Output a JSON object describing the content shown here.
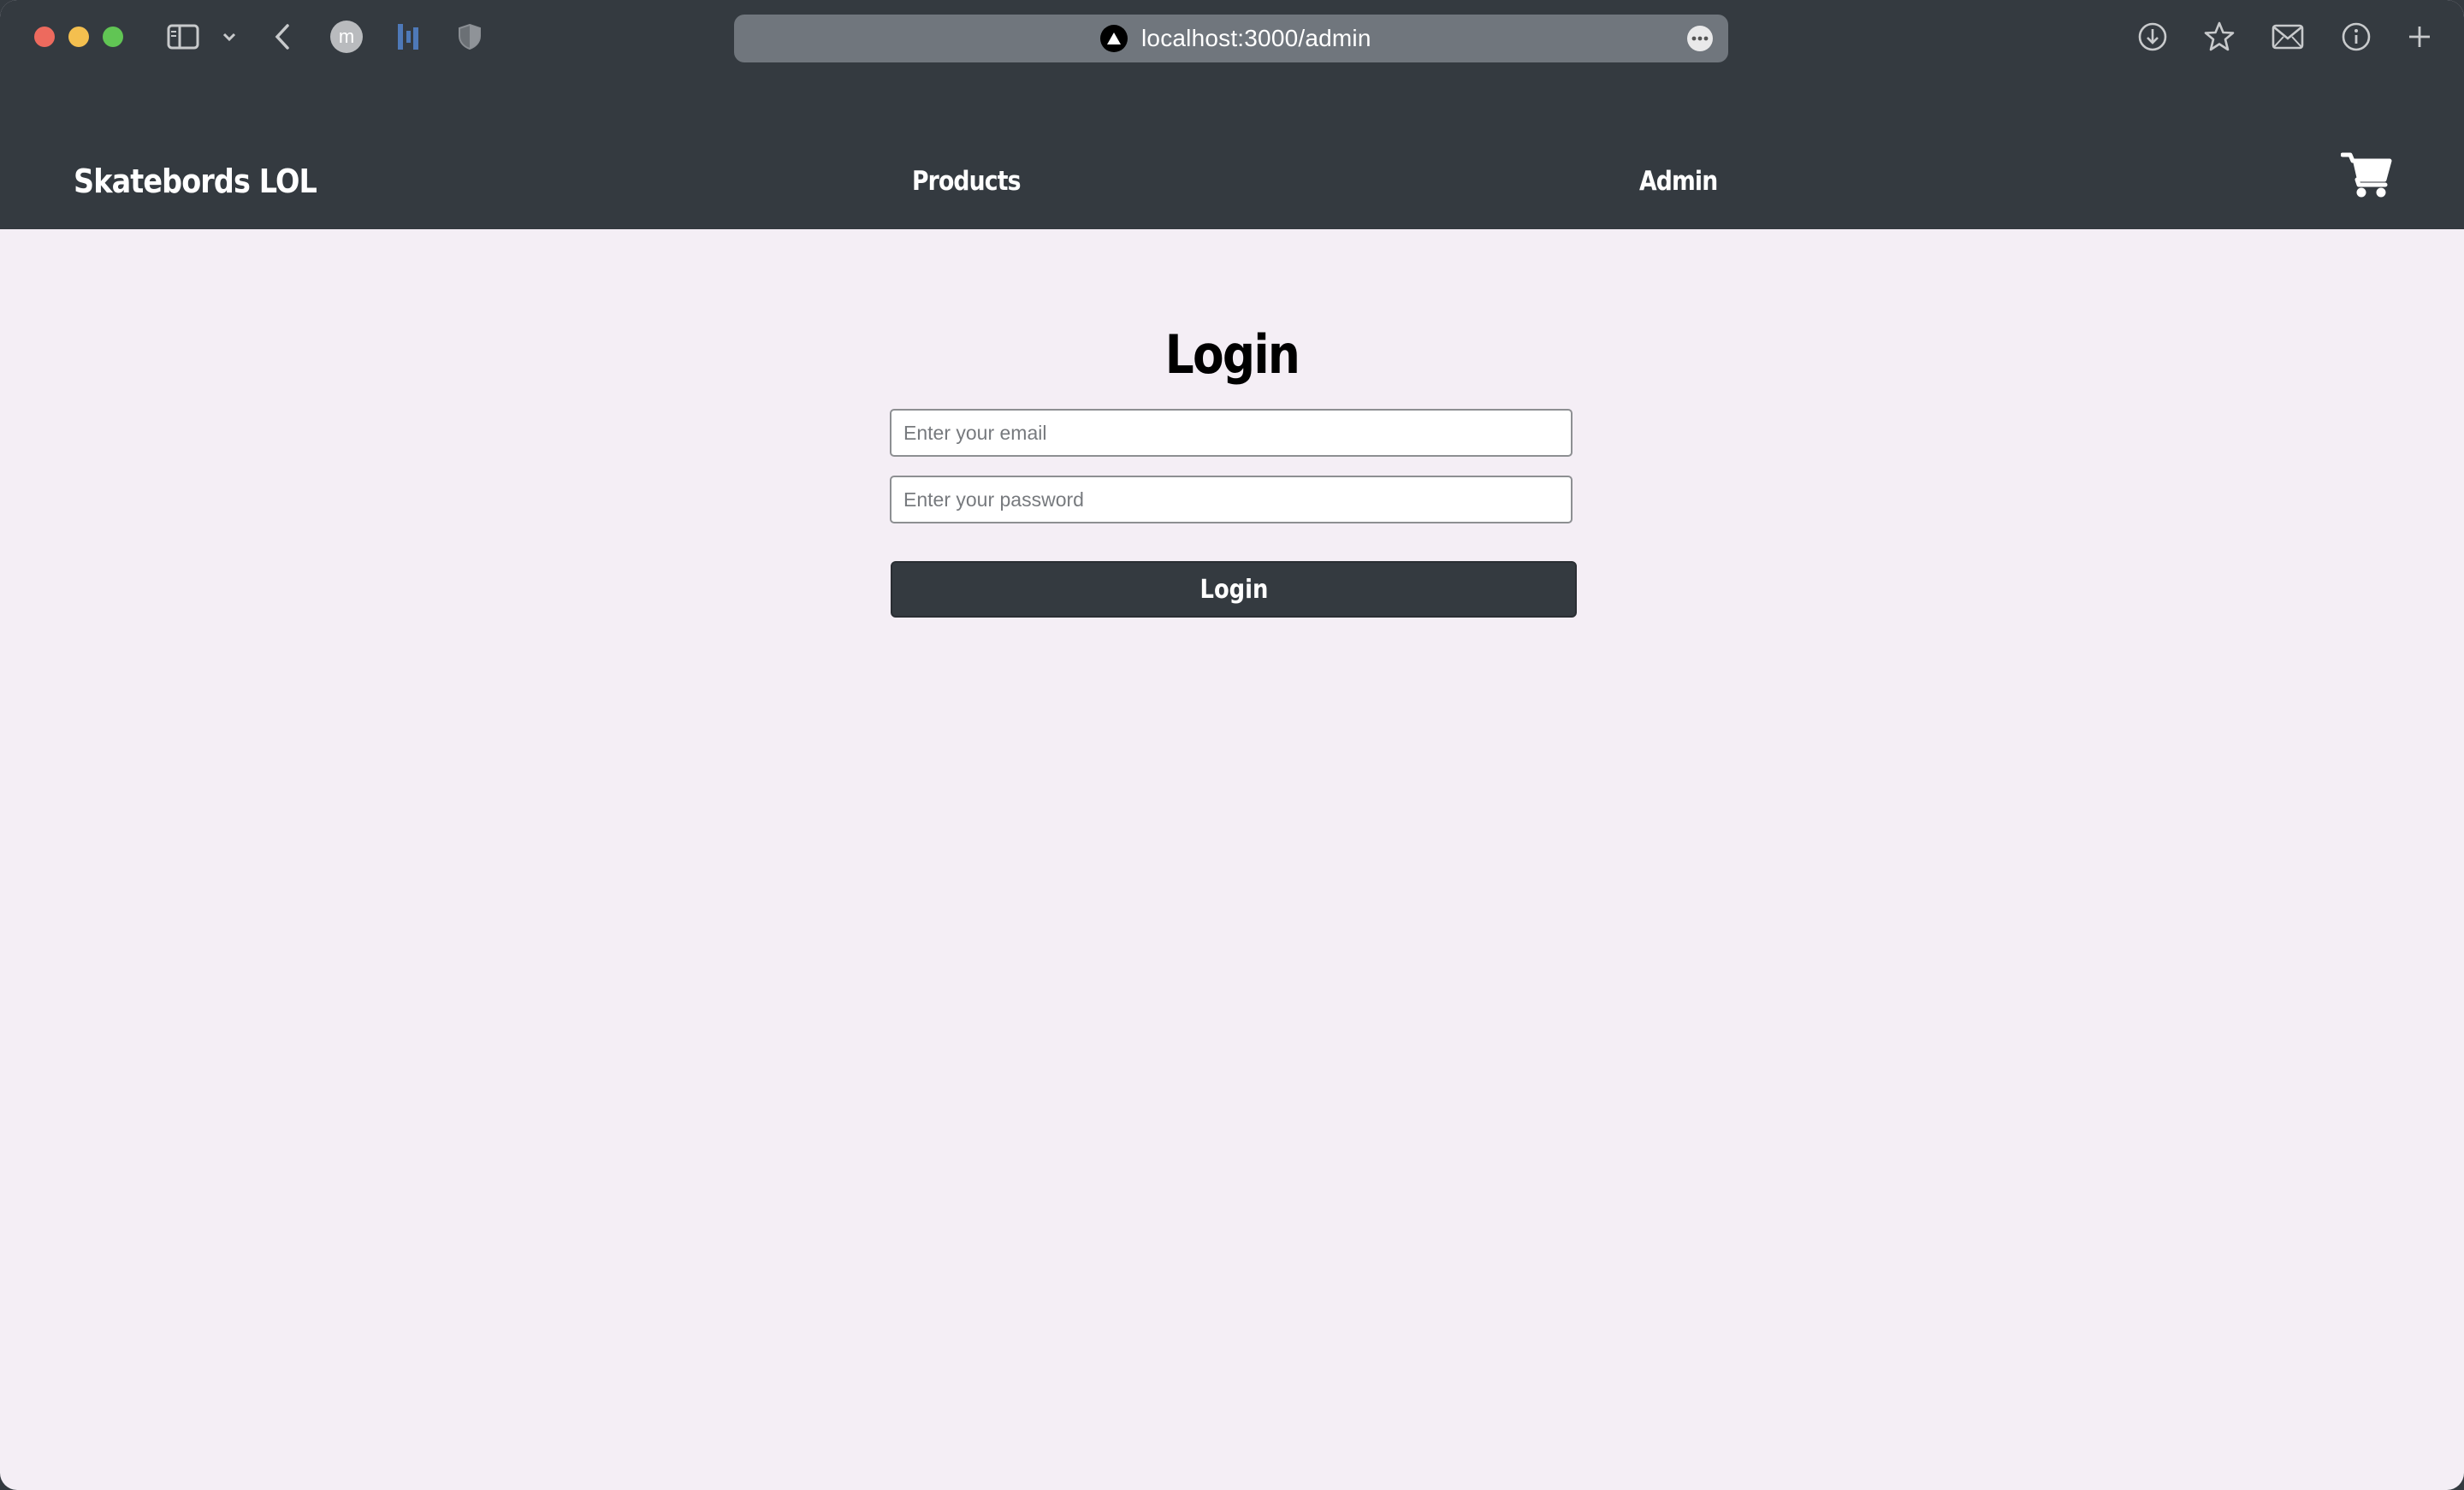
{
  "browser": {
    "url": "localhost:3000/admin",
    "profile_initial": "m",
    "icons": [
      "sidebar-toggle-icon",
      "chevron-down-icon",
      "back-arrow-icon",
      "profile-avatar-icon",
      "extension-bars-icon",
      "shield-icon",
      "site-favicon-icon",
      "more-options-icon",
      "download-icon",
      "bookmark-star-icon",
      "mail-icon",
      "info-icon",
      "new-tab-plus-icon"
    ]
  },
  "navbar": {
    "brand": "Skatebords LOL",
    "links": [
      {
        "label": "Products"
      },
      {
        "label": "Admin"
      }
    ],
    "cart_icon": "shopping-cart-icon"
  },
  "login": {
    "title": "Login",
    "email_placeholder": "Enter your email",
    "password_placeholder": "Enter your password",
    "button_label": "Login"
  },
  "colors": {
    "navbar_bg": "#343a40",
    "page_bg": "#f4eef5",
    "button_bg": "#343a40",
    "text_light": "#ffffff"
  }
}
